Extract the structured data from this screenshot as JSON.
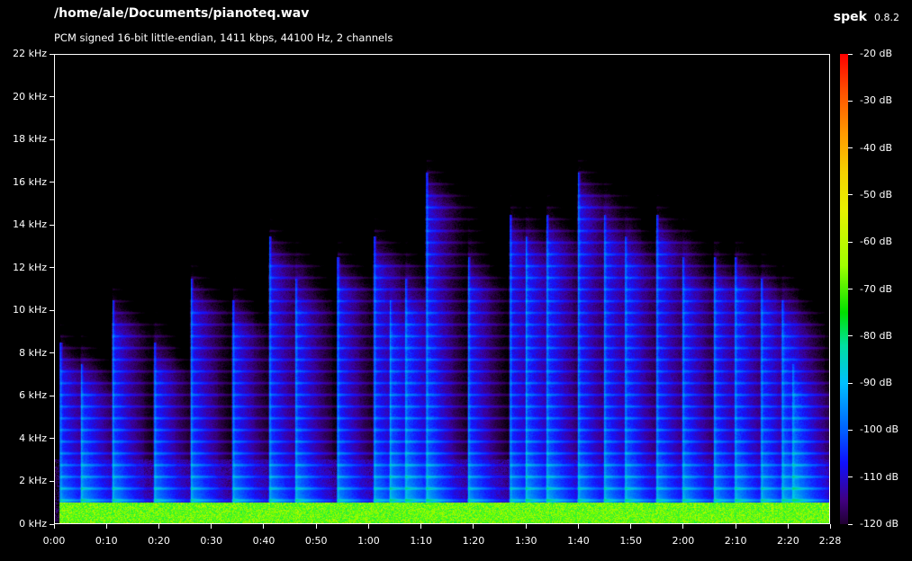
{
  "header": {
    "file_path": "/home/ale/Documents/pianoteq.wav",
    "file_info": "PCM signed 16-bit little-endian, 1411 kbps, 44100 Hz, 2 channels",
    "app_name": "spek",
    "app_version": "0.8.2"
  },
  "chart_data": {
    "type": "heatmap",
    "title": "/home/ale/Documents/pianoteq.wav",
    "subtitle": "PCM signed 16-bit little-endian, 1411 kbps, 44100 Hz, 2 channels",
    "y_axis": {
      "unit": "kHz",
      "range": [
        0,
        22
      ],
      "ticks": [
        "0 kHz",
        "2 kHz",
        "4 kHz",
        "6 kHz",
        "8 kHz",
        "10 kHz",
        "12 kHz",
        "14 kHz",
        "16 kHz",
        "18 kHz",
        "20 kHz",
        "22 kHz"
      ],
      "tick_values": [
        0,
        2,
        4,
        6,
        8,
        10,
        12,
        14,
        16,
        18,
        20,
        22
      ]
    },
    "x_axis": {
      "unit": "time",
      "range_seconds": [
        0,
        148
      ],
      "ticks": [
        "0:00",
        "0:10",
        "0:20",
        "0:30",
        "0:40",
        "0:50",
        "1:00",
        "1:10",
        "1:20",
        "1:30",
        "1:40",
        "1:50",
        "2:00",
        "2:10",
        "2:20",
        "2:28"
      ],
      "tick_seconds": [
        0,
        10,
        20,
        30,
        40,
        50,
        60,
        70,
        80,
        90,
        100,
        110,
        120,
        130,
        140,
        148
      ]
    },
    "colorbar": {
      "unit": "dB",
      "range": [
        -120,
        -20
      ],
      "ticks": [
        "-20 dB",
        "-30 dB",
        "-40 dB",
        "-50 dB",
        "-60 dB",
        "-70 dB",
        "-80 dB",
        "-90 dB",
        "-100 dB",
        "-110 dB",
        "-120 dB"
      ],
      "tick_values": [
        -20,
        -30,
        -40,
        -50,
        -60,
        -70,
        -80,
        -90,
        -100,
        -110,
        -120
      ]
    },
    "note_onsets_seconds": [
      1,
      5,
      11,
      19,
      26,
      34,
      41,
      46,
      54,
      61,
      64,
      67,
      71,
      79,
      87,
      90,
      94,
      100,
      105,
      109,
      115,
      120,
      126,
      130,
      135,
      139,
      141
    ],
    "max_harmonic_khz": [
      7,
      6,
      9,
      7,
      10,
      9,
      12,
      10,
      11,
      12,
      9,
      10,
      15,
      11,
      13,
      12,
      13,
      15,
      13,
      12,
      13,
      11,
      11,
      11,
      10,
      9,
      6
    ]
  }
}
